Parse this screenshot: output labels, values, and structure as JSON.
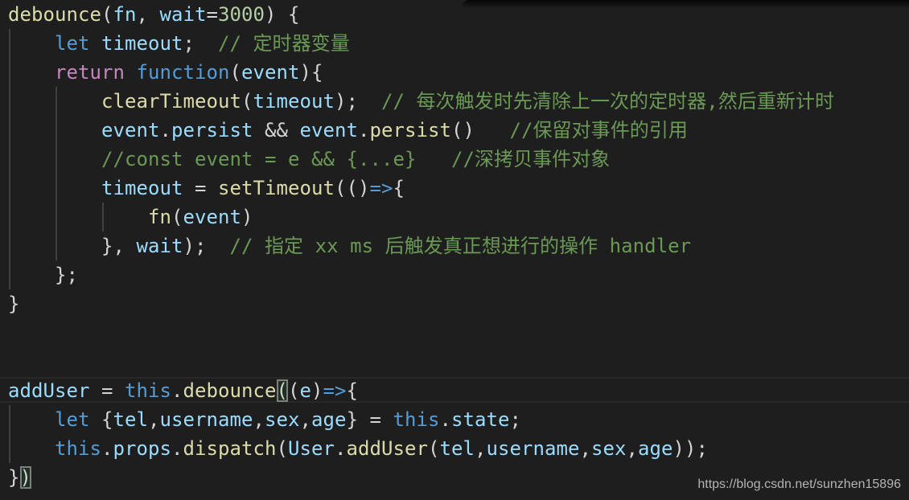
{
  "editor": {
    "theme_colors": {
      "background": "#1e1e1e",
      "function": "#dcdcaa",
      "variable": "#9cdcfe",
      "keyword": "#569cd6",
      "control": "#c586c0",
      "comment": "#6a9955",
      "number": "#b5cea8",
      "default": "#d4d4d4"
    },
    "lines": [
      {
        "line": 1,
        "tokens": [
          [
            "fn",
            "debounce"
          ],
          [
            "punc",
            "("
          ],
          [
            "var",
            "fn"
          ],
          [
            "punc",
            ", "
          ],
          [
            "var",
            "wait"
          ],
          [
            "op",
            "="
          ],
          [
            "num",
            "3000"
          ],
          [
            "punc",
            ") {"
          ]
        ]
      },
      {
        "line": 2,
        "tokens": [
          [
            "punc",
            "    "
          ],
          [
            "kw",
            "let"
          ],
          [
            "punc",
            " "
          ],
          [
            "var",
            "timeout"
          ],
          [
            "punc",
            ";  "
          ],
          [
            "cm",
            "// 定时器变量"
          ]
        ]
      },
      {
        "line": 3,
        "tokens": [
          [
            "punc",
            "    "
          ],
          [
            "ctl",
            "return"
          ],
          [
            "punc",
            " "
          ],
          [
            "kw",
            "function"
          ],
          [
            "punc",
            "("
          ],
          [
            "var",
            "event"
          ],
          [
            "punc",
            "){"
          ]
        ]
      },
      {
        "line": 4,
        "tokens": [
          [
            "punc",
            "        "
          ],
          [
            "fn",
            "clearTimeout"
          ],
          [
            "punc",
            "("
          ],
          [
            "var",
            "timeout"
          ],
          [
            "punc",
            ");  "
          ],
          [
            "cm",
            "// 每次触发时先清除上一次的定时器,然后重新计时"
          ]
        ]
      },
      {
        "line": 5,
        "tokens": [
          [
            "punc",
            "        "
          ],
          [
            "var",
            "event"
          ],
          [
            "punc",
            "."
          ],
          [
            "var",
            "persist"
          ],
          [
            "op",
            " && "
          ],
          [
            "var",
            "event"
          ],
          [
            "punc",
            "."
          ],
          [
            "fn",
            "persist"
          ],
          [
            "punc",
            "()   "
          ],
          [
            "cm",
            "//保留对事件的引用"
          ]
        ]
      },
      {
        "line": 6,
        "tokens": [
          [
            "punc",
            "        "
          ],
          [
            "cm",
            "//const event = e && {...e}   //深拷贝事件对象"
          ]
        ]
      },
      {
        "line": 7,
        "tokens": [
          [
            "punc",
            "        "
          ],
          [
            "var",
            "timeout"
          ],
          [
            "op",
            " = "
          ],
          [
            "fn",
            "setTimeout"
          ],
          [
            "punc",
            "(()"
          ],
          [
            "arrow",
            "=>"
          ],
          [
            "punc",
            "{"
          ]
        ]
      },
      {
        "line": 8,
        "tokens": [
          [
            "punc",
            "            "
          ],
          [
            "fn",
            "fn"
          ],
          [
            "punc",
            "("
          ],
          [
            "var",
            "event"
          ],
          [
            "punc",
            ")"
          ]
        ]
      },
      {
        "line": 9,
        "tokens": [
          [
            "punc",
            "        }, "
          ],
          [
            "var",
            "wait"
          ],
          [
            "punc",
            ");  "
          ],
          [
            "cm",
            "// 指定 xx ms 后触发真正想进行的操作 handler"
          ]
        ]
      },
      {
        "line": 10,
        "tokens": [
          [
            "punc",
            "    };"
          ]
        ]
      },
      {
        "line": 11,
        "tokens": [
          [
            "punc",
            "}"
          ]
        ]
      },
      {
        "line": 12,
        "tokens": []
      },
      {
        "line": 13,
        "tokens": []
      },
      {
        "line": 14,
        "tokens": [
          [
            "var",
            "addUser"
          ],
          [
            "op",
            " = "
          ],
          [
            "kw",
            "this"
          ],
          [
            "punc",
            "."
          ],
          [
            "fn",
            "debounce"
          ],
          [
            "match",
            "("
          ],
          [
            "punc",
            "("
          ],
          [
            "var",
            "e"
          ],
          [
            "punc",
            ")"
          ],
          [
            "arrow",
            "=>"
          ],
          [
            "punc",
            "{"
          ]
        ]
      },
      {
        "line": 15,
        "tokens": [
          [
            "punc",
            "    "
          ],
          [
            "kw",
            "let"
          ],
          [
            "punc",
            " {"
          ],
          [
            "var",
            "tel"
          ],
          [
            "punc",
            ","
          ],
          [
            "var",
            "username"
          ],
          [
            "punc",
            ","
          ],
          [
            "var",
            "sex"
          ],
          [
            "punc",
            ","
          ],
          [
            "var",
            "age"
          ],
          [
            "punc",
            "}"
          ],
          [
            "op",
            " = "
          ],
          [
            "kw",
            "this"
          ],
          [
            "punc",
            "."
          ],
          [
            "var",
            "state"
          ],
          [
            "punc",
            ";"
          ]
        ]
      },
      {
        "line": 16,
        "tokens": [
          [
            "punc",
            "    "
          ],
          [
            "kw",
            "this"
          ],
          [
            "punc",
            "."
          ],
          [
            "var",
            "props"
          ],
          [
            "punc",
            "."
          ],
          [
            "fn",
            "dispatch"
          ],
          [
            "punc",
            "("
          ],
          [
            "var",
            "User"
          ],
          [
            "punc",
            "."
          ],
          [
            "fn",
            "addUser"
          ],
          [
            "punc",
            "("
          ],
          [
            "var",
            "tel"
          ],
          [
            "punc",
            ","
          ],
          [
            "var",
            "username"
          ],
          [
            "punc",
            ","
          ],
          [
            "var",
            "sex"
          ],
          [
            "punc",
            ","
          ],
          [
            "var",
            "age"
          ],
          [
            "punc",
            "));"
          ]
        ]
      },
      {
        "line": 17,
        "tokens": [
          [
            "punc",
            "}"
          ],
          [
            "match",
            ")"
          ]
        ]
      }
    ]
  },
  "watermark": "https://blog.csdn.net/sunzhen15896"
}
